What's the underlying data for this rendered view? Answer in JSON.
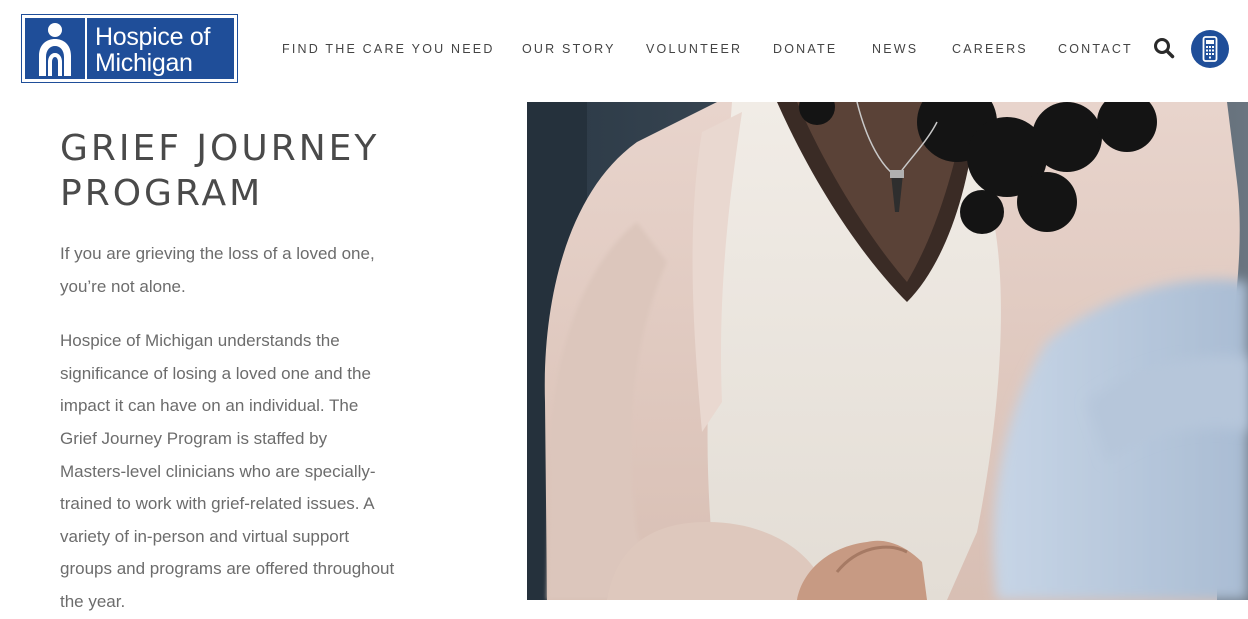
{
  "brand": {
    "logo_line1": "Hospice of",
    "logo_line2": "Michigan",
    "color": "#1f4e99"
  },
  "nav": {
    "items": [
      {
        "label": "FIND THE CARE YOU NEED"
      },
      {
        "label": "OUR STORY"
      },
      {
        "label": "VOLUNTEER"
      },
      {
        "label": "DONATE"
      },
      {
        "label": "NEWS"
      },
      {
        "label": "CAREERS"
      },
      {
        "label": "CONTACT"
      }
    ],
    "search_icon": "search-icon",
    "phone_icon": "phone-icon"
  },
  "main": {
    "title_line1": "GRIEF JOURNEY",
    "title_line2": "PROGRAM",
    "intro": "If you are grieving the loss of a loved one, you’re not alone.",
    "body": "Hospice of Michigan understands the significance of losing a loved one and the impact it can have on an individual. The Grief Journey Program is staffed by Masters-level clinicians who are specially-trained to work with grief-related issues. A variety of in-person and virtual support groups and programs are offered throughout the year."
  },
  "hero": {
    "description_icon": "photo-woman-clasped-hands"
  }
}
